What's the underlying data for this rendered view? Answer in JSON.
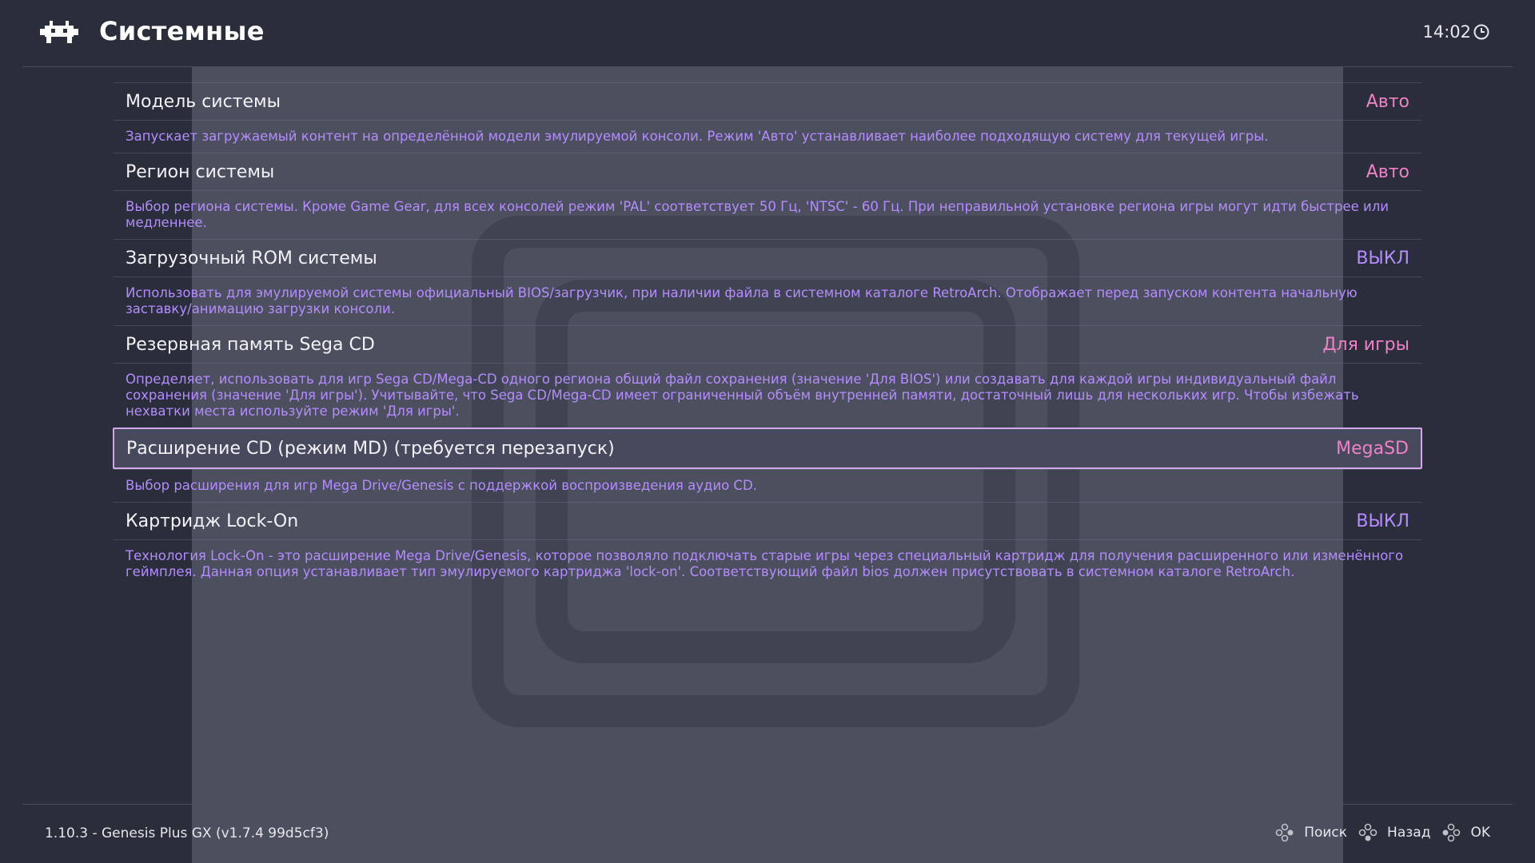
{
  "header": {
    "title": "Системные",
    "clock": "14:02"
  },
  "settings": [
    {
      "label": "Модель системы",
      "value": "Авто",
      "value_color": "pink",
      "description": "Запускает загружаемый контент на определённой модели эмулируемой консоли. Режим 'Авто' устанавливает наиболее подходящую систему для текущей игры."
    },
    {
      "label": "Регион системы",
      "value": "Авто",
      "value_color": "pink",
      "description": "Выбор региона системы. Кроме Game Gear, для всех консолей режим 'PAL' соответствует 50 Гц, 'NTSC' - 60 Гц. При неправильной установке региона игры могут идти быстрее или медленнее."
    },
    {
      "label": "Загрузочный ROM системы",
      "value": "ВЫКЛ",
      "value_color": "purple",
      "description": "Использовать для эмулируемой системы официальный BIOS/загрузчик, при наличии файла в системном каталоге RetroArch. Отображает перед запуском контента начальную заставку/анимацию загрузки консоли."
    },
    {
      "label": "Резервная память Sega CD",
      "value": "Для игры",
      "value_color": "pink",
      "description": "Определяет, использовать для игр Sega CD/Mega-CD одного региона общий файл сохранения (значение 'Для BIOS') или создавать для каждой игры индивидуальный файл сохранения (значение 'Для игры'). Учитывайте, что Sega CD/Mega-CD имеет ограниченный объём внутренней памяти, достаточный лишь для нескольких игр. Чтобы избежать нехватки места используйте режим 'Для игры'."
    },
    {
      "label": "Расширение CD (режим MD) (требуется перезапуск)",
      "value": "MegaSD",
      "value_color": "pink",
      "selected": true,
      "description": "Выбор расширения для игр Mega Drive/Genesis с поддержкой воспроизведения аудио CD."
    },
    {
      "label": "Картридж Lock-On",
      "value": "ВЫКЛ",
      "value_color": "purple",
      "description": "Технология Lock-On - это расширение Mega Drive/Genesis, которое позволяло подключать старые игры через специальный картридж для получения расширенного или изменённого геймплея. Данная опция устанавливает тип эмулируемого картриджа 'lock-on'. Соответствующий файл bios должен присутствовать в системном каталоге RetroArch."
    }
  ],
  "footer": {
    "version": "1.10.3 - Genesis Plus GX (v1.7.4 99d5cf3)",
    "actions": {
      "search": "Поиск",
      "back": "Назад",
      "ok": "OK"
    }
  },
  "colors": {
    "background": "#2a2d3a",
    "value_pink": "#f080c8",
    "value_purple": "#b48cff",
    "description": "#b48cff",
    "selection_border": "#d2a8e8"
  },
  "icons": {
    "logo": "retroarch-invader-icon",
    "clock": "clock-icon",
    "gamepad": "gamepad-buttons-icon"
  }
}
